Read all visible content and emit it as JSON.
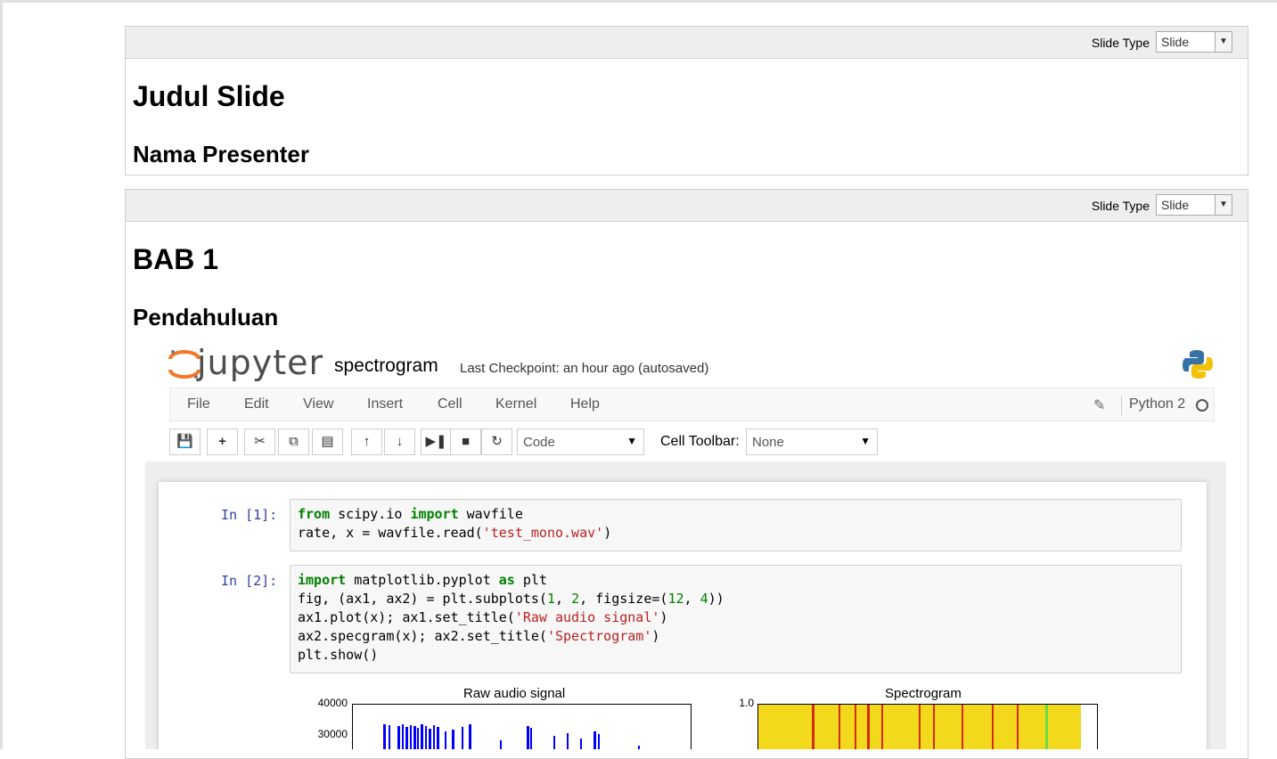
{
  "slides": [
    {
      "slide_type_label": "Slide Type",
      "slide_type_value": "Slide",
      "heading1": "Judul Slide",
      "heading2": "Nama Presenter"
    },
    {
      "slide_type_label": "Slide Type",
      "slide_type_value": "Slide",
      "heading1": "BAB 1",
      "heading2": "Pendahuluan"
    }
  ],
  "jupyter": {
    "logo_text": "jupyter",
    "notebook_title": "spectrogram",
    "checkpoint": "Last Checkpoint: an hour ago (autosaved)",
    "menu": [
      "File",
      "Edit",
      "View",
      "Insert",
      "Cell",
      "Kernel",
      "Help"
    ],
    "kernel": "Python 2",
    "toolbar_icons": [
      "save-icon",
      "plus-icon",
      "scissors-icon",
      "copy-icon",
      "paste-icon",
      "arrow-up-icon",
      "arrow-down-icon",
      "run-icon",
      "stop-icon",
      "restart-icon"
    ],
    "cell_type": "Code",
    "cell_toolbar_label": "Cell Toolbar:",
    "cell_toolbar_value": "None",
    "cells": [
      {
        "prompt": "In [1]:",
        "lines": [
          "from scipy.io import wavfile",
          "rate, x = wavfile.read('test_mono.wav')"
        ]
      },
      {
        "prompt": "In [2]:",
        "lines": [
          "import matplotlib.pyplot as plt",
          "fig, (ax1, ax2) = plt.subplots(1, 2, figsize=(12, 4))",
          "ax1.plot(x); ax1.set_title('Raw audio signal')",
          "ax2.specgram(x); ax2.set_title('Spectrogram')",
          "plt.show()"
        ]
      }
    ],
    "figures": {
      "left_title": "Raw audio signal",
      "left_yticks": [
        "40000",
        "30000"
      ],
      "right_title": "Spectrogram",
      "right_yticks": [
        "1.0"
      ]
    }
  },
  "colors": {
    "signal": "#0000ff",
    "spectrogram_bg": "#f2d91c",
    "spectrogram_line": "#d62b10",
    "spectrogram_green": "#66dd44"
  }
}
